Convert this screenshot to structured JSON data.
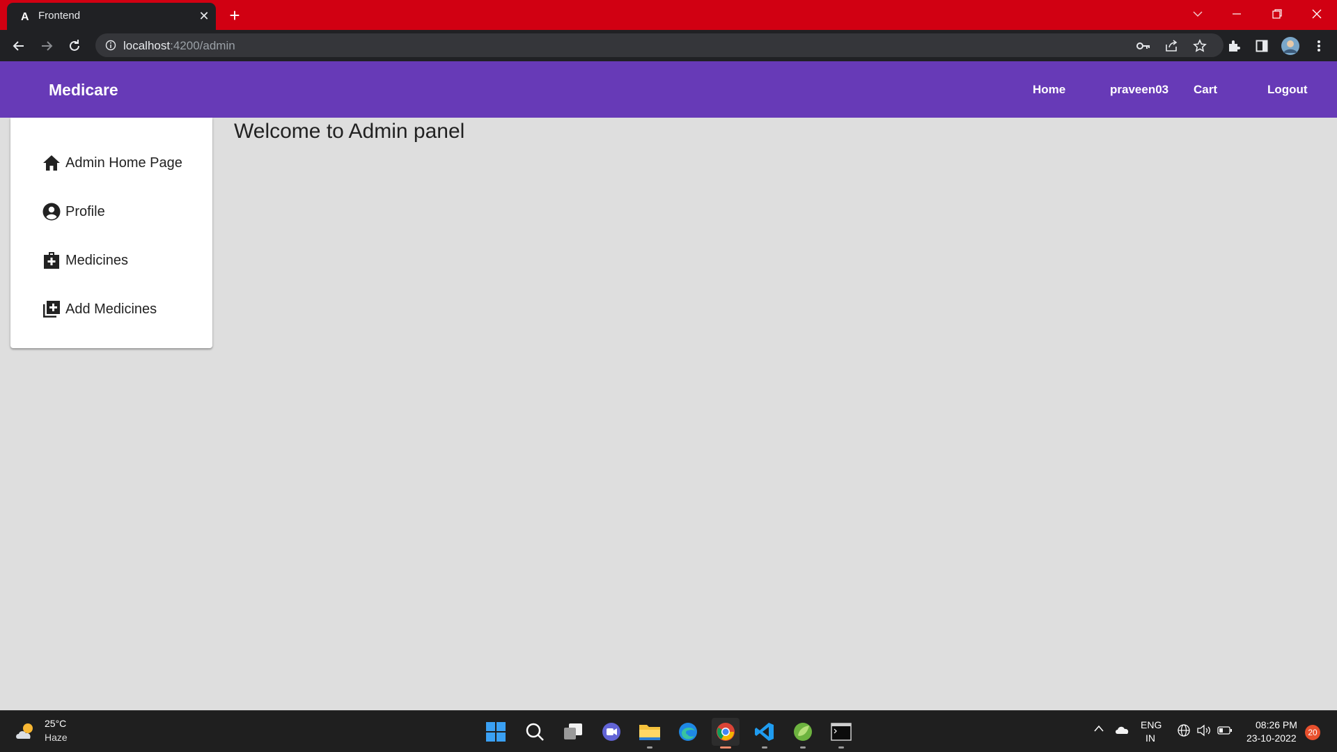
{
  "browser": {
    "tab_title": "Frontend",
    "tab_close": "✕",
    "new_tab": "+",
    "url_host": "localhost",
    "url_path": ":4200/admin"
  },
  "app": {
    "brand": "Medicare",
    "nav": {
      "home": "Home",
      "user": "praveen03",
      "cart": "Cart",
      "logout": "Logout"
    },
    "accent_color": "#673ab7"
  },
  "sidebar": {
    "items": [
      {
        "label": "Admin Home Page",
        "icon": "home-icon"
      },
      {
        "label": "Profile",
        "icon": "account-circle-icon"
      },
      {
        "label": "Medicines",
        "icon": "medical-bag-icon"
      },
      {
        "label": "Add Medicines",
        "icon": "library-add-icon"
      }
    ]
  },
  "main": {
    "heading": "Welcome to Admin panel"
  },
  "taskbar": {
    "weather_temp": "25°C",
    "weather_desc": "Haze",
    "lang_line1": "ENG",
    "lang_line2": "IN",
    "time": "08:26 PM",
    "date": "23-10-2022",
    "notification_count": "20"
  }
}
